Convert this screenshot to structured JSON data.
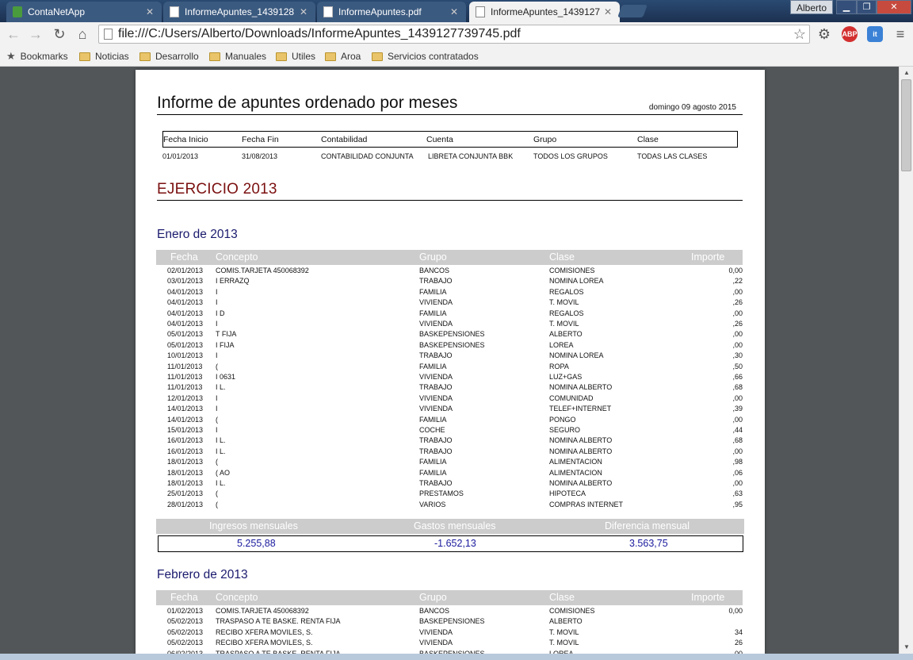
{
  "browser": {
    "tabs": [
      {
        "label": "ContaNetApp",
        "icon": "app-icon"
      },
      {
        "label": "InformeApuntes_1439128",
        "icon": "document-icon"
      },
      {
        "label": "InformeApuntes.pdf",
        "icon": "document-icon"
      },
      {
        "label": "InformeApuntes_1439127",
        "icon": "document-icon",
        "active": true
      }
    ],
    "user": "Alberto",
    "url": "file:///C:/Users/Alberto/Downloads/InformeApuntes_1439127739745.pdf",
    "bookmarks": [
      "Bookmarks",
      "Noticias",
      "Desarrollo",
      "Manuales",
      "Utiles",
      "Aroa",
      "Servicios contratados"
    ],
    "extensions": [
      "ABP",
      "it"
    ]
  },
  "report": {
    "title": "Informe de apuntes ordenado por meses",
    "date": "domingo 09 agosto 2015",
    "params": {
      "labels": [
        "Fecha Inicio",
        "Fecha Fin",
        "Contabilidad",
        "Cuenta",
        "Grupo",
        "Clase"
      ],
      "values": [
        "01/01/2013",
        "31/08/2013",
        "CONTABILIDAD CONJUNTA",
        "LIBRETA CONJUNTA BBK",
        "TODOS LOS GRUPOS",
        "TODAS LAS CLASES"
      ]
    },
    "ejercicio": "EJERCICIO 2013",
    "columns": [
      "Fecha",
      "Concepto",
      "Grupo",
      "Clase",
      "Importe"
    ],
    "months": [
      {
        "name": "Enero de 2013",
        "rows": [
          {
            "fecha": "02/01/2013",
            "concepto": "COMIS.TARJETA 450068392",
            "grupo": "BANCOS",
            "clase": "COMISIONES",
            "importe": "0,00"
          },
          {
            "fecha": "03/01/2013",
            "concepto": "I ERRAZQ",
            "grupo": "TRABAJO",
            "clase": "NOMINA LOREA",
            "importe": ",22"
          },
          {
            "fecha": "04/01/2013",
            "concepto": "I",
            "grupo": "FAMILIA",
            "clase": "REGALOS",
            "importe": ",00"
          },
          {
            "fecha": "04/01/2013",
            "concepto": "I",
            "grupo": "VIVIENDA",
            "clase": "T. MOVIL",
            "importe": ",26"
          },
          {
            "fecha": "04/01/2013",
            "concepto": "I D",
            "grupo": "FAMILIA",
            "clase": "REGALOS",
            "importe": ",00"
          },
          {
            "fecha": "04/01/2013",
            "concepto": "I",
            "grupo": "VIVIENDA",
            "clase": "T. MOVIL",
            "importe": ",26"
          },
          {
            "fecha": "05/01/2013",
            "concepto": "T FIJA",
            "grupo": "BASKEPENSIONES",
            "clase": "ALBERTO",
            "importe": ",00"
          },
          {
            "fecha": "05/01/2013",
            "concepto": "I FIJA",
            "grupo": "BASKEPENSIONES",
            "clase": "LOREA",
            "importe": ",00"
          },
          {
            "fecha": "10/01/2013",
            "concepto": "I",
            "grupo": "TRABAJO",
            "clase": "NOMINA LOREA",
            "importe": ",30"
          },
          {
            "fecha": "11/01/2013",
            "concepto": "(",
            "grupo": "FAMILIA",
            "clase": "ROPA",
            "importe": ",50"
          },
          {
            "fecha": "11/01/2013",
            "concepto": "I 0631",
            "grupo": "VIVIENDA",
            "clase": "LUZ+GAS",
            "importe": ",66"
          },
          {
            "fecha": "11/01/2013",
            "concepto": "I L.",
            "grupo": "TRABAJO",
            "clase": "NOMINA ALBERTO",
            "importe": ",68"
          },
          {
            "fecha": "12/01/2013",
            "concepto": "I",
            "grupo": "VIVIENDA",
            "clase": "COMUNIDAD",
            "importe": ",00"
          },
          {
            "fecha": "14/01/2013",
            "concepto": "I",
            "grupo": "VIVIENDA",
            "clase": "TELEF+INTERNET",
            "importe": ",39"
          },
          {
            "fecha": "14/01/2013",
            "concepto": "(",
            "grupo": "FAMILIA",
            "clase": "PONGO",
            "importe": ",00"
          },
          {
            "fecha": "15/01/2013",
            "concepto": "I",
            "grupo": "COCHE",
            "clase": "SEGURO",
            "importe": ",44"
          },
          {
            "fecha": "16/01/2013",
            "concepto": "I L.",
            "grupo": "TRABAJO",
            "clase": "NOMINA ALBERTO",
            "importe": ",68"
          },
          {
            "fecha": "16/01/2013",
            "concepto": "I L.",
            "grupo": "TRABAJO",
            "clase": "NOMINA ALBERTO",
            "importe": ",00"
          },
          {
            "fecha": "18/01/2013",
            "concepto": "(",
            "grupo": "FAMILIA",
            "clase": "ALIMENTACION",
            "importe": ",98"
          },
          {
            "fecha": "18/01/2013",
            "concepto": "( AO",
            "grupo": "FAMILIA",
            "clase": "ALIMENTACION",
            "importe": ",06"
          },
          {
            "fecha": "18/01/2013",
            "concepto": "I L.",
            "grupo": "TRABAJO",
            "clase": "NOMINA ALBERTO",
            "importe": ",00"
          },
          {
            "fecha": "25/01/2013",
            "concepto": "(",
            "grupo": "PRESTAMOS",
            "clase": "HIPOTECA",
            "importe": ",63"
          },
          {
            "fecha": "28/01/2013",
            "concepto": "(",
            "grupo": "VARIOS",
            "clase": "COMPRAS INTERNET",
            "importe": ",95"
          }
        ],
        "summary": {
          "labels": [
            "Ingresos mensuales",
            "Gastos mensuales",
            "Diferencia mensual"
          ],
          "values": [
            "5.255,88",
            "-1.652,13",
            "3.563,75"
          ]
        }
      },
      {
        "name": "Febrero de 2013",
        "rows": [
          {
            "fecha": "01/02/2013",
            "concepto": "COMIS.TARJETA 450068392",
            "grupo": "BANCOS",
            "clase": "COMISIONES",
            "importe": "0,00"
          },
          {
            "fecha": "05/02/2013",
            "concepto": "TRASPASO A TE BASKE. RENTA FIJA",
            "grupo": "BASKEPENSIONES",
            "clase": "ALBERTO",
            "importe": ""
          },
          {
            "fecha": "05/02/2013",
            "concepto": "RECIBO XFERA MOVILES, S.",
            "grupo": "VIVIENDA",
            "clase": "T. MOVIL",
            "importe": "34"
          },
          {
            "fecha": "05/02/2013",
            "concepto": "RECIBO XFERA MOVILES, S.",
            "grupo": "VIVIENDA",
            "clase": "T. MOVIL",
            "importe": "26"
          },
          {
            "fecha": "06/02/2013",
            "concepto": "TRASPASO A TE BASKE. RENTA FIJA",
            "grupo": "BASKEPENSIONES",
            "clase": "LOREA",
            "importe": "00"
          }
        ]
      }
    ]
  }
}
